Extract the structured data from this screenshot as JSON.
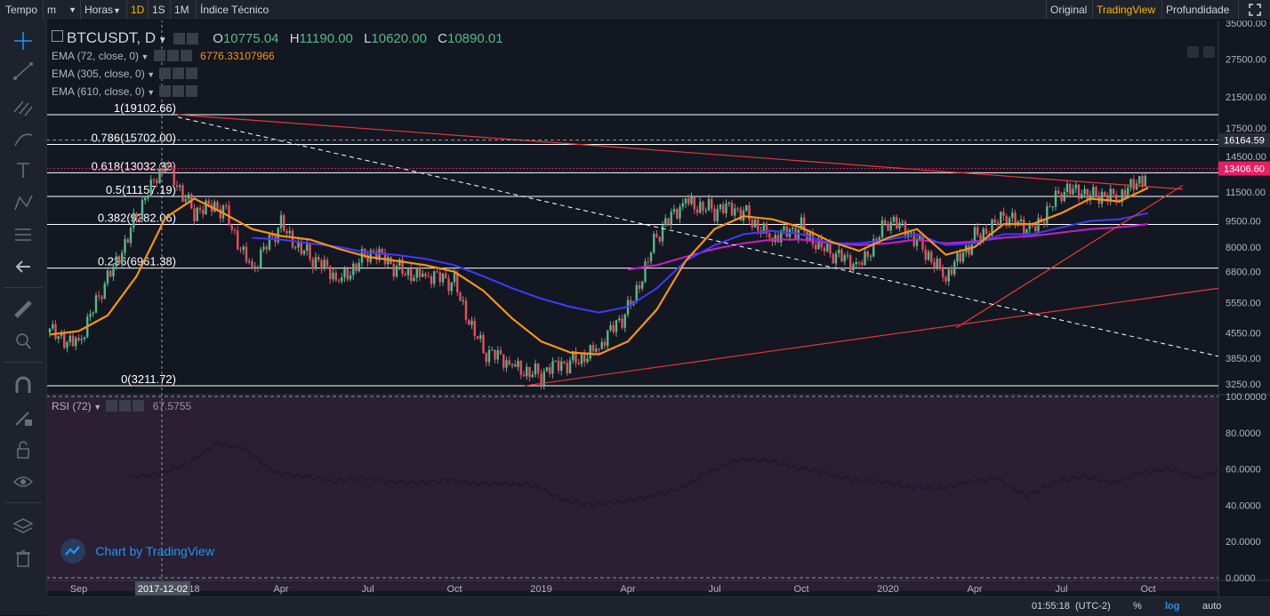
{
  "toolbar": {
    "tempo": "Tempo",
    "interval": "m",
    "hours": "Horas",
    "tf_1d": "1D",
    "tf_1s": "1S",
    "tf_1m": "1M",
    "indicators": "Índice Técnico",
    "view_original": "Original",
    "view_tradingview": "TradingView",
    "view_depth": "Profundidade"
  },
  "legend": {
    "symbol": "BTCUSDT, D",
    "o_label": "O",
    "o": "10775.04",
    "h_label": "H",
    "h": "11190.00",
    "l_label": "L",
    "l": "10620.00",
    "c_label": "C",
    "c": "10890.01",
    "ema1": "EMA (72, close, 0)",
    "ema1_value": "6776.33107966",
    "ema2": "EMA (305, close, 0)",
    "ema3": "EMA (610, close, 0)",
    "rsi": "RSI (72)",
    "rsi_value": "67.5755"
  },
  "fib": [
    {
      "label": "1(19102.66)",
      "price": 19102.66
    },
    {
      "label": "0.786(15702.00)",
      "price": 15702.0
    },
    {
      "label": "0.618(13032.32)",
      "price": 13032.32
    },
    {
      "label": "0.5(11157.19)",
      "price": 11157.19
    },
    {
      "label": "0.382(9282.06)",
      "price": 9282.06
    },
    {
      "label": "0.236(6961.38)",
      "price": 6961.38
    },
    {
      "label": "0(3211.72)",
      "price": 3211.72
    }
  ],
  "price_axis": {
    "ticks": [
      "35000.00",
      "27500.00",
      "21500.00",
      "17500.00",
      "14500.00",
      "11500.00",
      "9500.00",
      "8000.00",
      "6800.00",
      "5550.00",
      "4550.00",
      "3850.00",
      "3250.00"
    ],
    "marker_high": "16164.59",
    "marker_last": "13406.60",
    "marker_last_color": "#e91e63",
    "scale": "log"
  },
  "rsi_axis": {
    "ticks": [
      "100.0000",
      "80.0000",
      "60.0000",
      "40.0000",
      "20.0000",
      "0.0000"
    ]
  },
  "time_axis": {
    "labels": [
      "Sep",
      "18",
      "Apr",
      "Jul",
      "Oct",
      "2019",
      "Apr",
      "Jul",
      "Oct",
      "2020",
      "Apr",
      "Jul",
      "Oct"
    ],
    "crosshair_label": "2017-12-02"
  },
  "bottom": {
    "time": "01:55:18",
    "tz": "(UTC-2)",
    "percent": "%",
    "log": "log",
    "auto": "auto"
  },
  "watermark": "Chart by TradingView",
  "colors": {
    "background": "#131722",
    "up": "#53b987",
    "down": "#eb4d5c",
    "ema72": "#f7931a",
    "ema305": "#3c3cff",
    "ema610": "#c71fc7",
    "fib": "#ffffff",
    "trend": "#e53935",
    "rsi_bg": "#2a1f33",
    "rsi_line": "#1a1a22"
  },
  "chart_data": {
    "type": "candlestick",
    "symbol": "BTCUSDT",
    "interval": "D",
    "scale": "log",
    "x": [
      "2017-08",
      "2017-09",
      "2017-10",
      "2017-11",
      "2017-12",
      "2018-01",
      "2018-02",
      "2018-03",
      "2018-04",
      "2018-05",
      "2018-06",
      "2018-07",
      "2018-08",
      "2018-09",
      "2018-10",
      "2018-11",
      "2018-12",
      "2019-01",
      "2019-02",
      "2019-03",
      "2019-04",
      "2019-05",
      "2019-06",
      "2019-07",
      "2019-08",
      "2019-09",
      "2019-10",
      "2019-11",
      "2019-12",
      "2020-01",
      "2020-02",
      "2020-03",
      "2020-04",
      "2020-05",
      "2020-06",
      "2020-07",
      "2020-08",
      "2020-09",
      "2020-10"
    ],
    "close": [
      4550,
      4300,
      6400,
      9900,
      13800,
      10200,
      10300,
      6900,
      9200,
      7500,
      6400,
      7800,
      7000,
      6600,
      6300,
      4000,
      3700,
      3450,
      3800,
      4100,
      5300,
      8500,
      11000,
      10100,
      10300,
      8300,
      9200,
      7500,
      7200,
      9400,
      8600,
      6400,
      8700,
      9500,
      9150,
      11300,
      11700,
      10800,
      13400
    ],
    "ema72": [
      4500,
      4600,
      5100,
      6600,
      9700,
      11000,
      10000,
      9000,
      8600,
      8400,
      7900,
      7500,
      7300,
      7100,
      6800,
      6000,
      5000,
      4300,
      4000,
      3950,
      4300,
      5300,
      7300,
      9000,
      9800,
      9600,
      9100,
      8300,
      7800,
      8500,
      9000,
      7600,
      8000,
      9300,
      9300,
      10000,
      11000,
      10800,
      11800
    ],
    "ema305": [
      null,
      null,
      null,
      null,
      null,
      null,
      null,
      8500,
      8400,
      8200,
      8000,
      7700,
      7600,
      7400,
      7100,
      6600,
      6100,
      5700,
      5400,
      5200,
      5400,
      6100,
      7300,
      8100,
      8700,
      8900,
      8700,
      8200,
      8200,
      8400,
      8700,
      8100,
      8200,
      8700,
      8700,
      9100,
      9500,
      9600,
      10000
    ],
    "ema610": [
      null,
      null,
      null,
      null,
      null,
      null,
      null,
      null,
      null,
      null,
      null,
      null,
      null,
      null,
      null,
      null,
      null,
      null,
      null,
      null,
      6900,
      7100,
      7500,
      7900,
      8200,
      8400,
      8400,
      8200,
      8100,
      8200,
      8400,
      8200,
      8300,
      8500,
      8600,
      8800,
      9000,
      9100,
      9300
    ],
    "rsi": [
      56,
      57,
      63,
      74,
      71,
      58,
      56,
      53,
      55,
      53,
      52,
      54,
      52,
      52,
      51,
      43,
      40,
      42,
      45,
      49,
      58,
      65,
      65,
      61,
      58,
      54,
      53,
      50,
      49,
      53,
      55,
      45,
      53,
      56,
      52,
      58,
      60,
      55,
      61
    ],
    "fib_levels": [
      19102.66,
      15702.0,
      13032.32,
      11157.19,
      9282.06,
      6961.38,
      3211.72
    ],
    "ylim": [
      3100,
      36000
    ],
    "rsi_ylim": [
      0,
      100
    ]
  }
}
